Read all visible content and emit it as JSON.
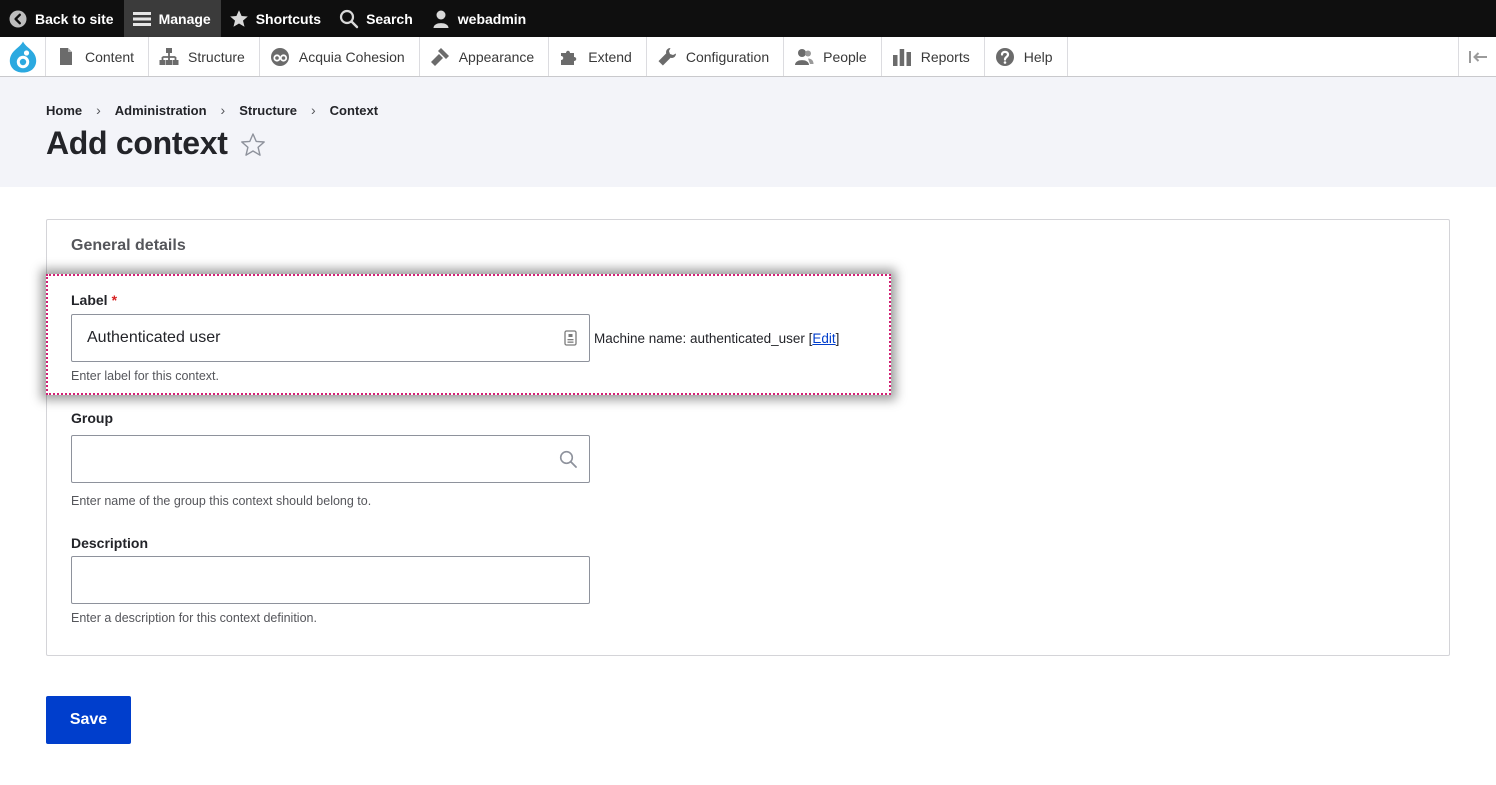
{
  "toolbar": {
    "back_to_site": "Back to site",
    "manage": "Manage",
    "shortcuts": "Shortcuts",
    "search": "Search",
    "user": "webadmin"
  },
  "tray": {
    "items": [
      {
        "label": "Content",
        "icon": "page-icon"
      },
      {
        "label": "Structure",
        "icon": "sitemap-icon"
      },
      {
        "label": "Acquia Cohesion",
        "icon": "cohesion-icon"
      },
      {
        "label": "Appearance",
        "icon": "paintbrush-icon"
      },
      {
        "label": "Extend",
        "icon": "puzzle-icon"
      },
      {
        "label": "Configuration",
        "icon": "wrench-icon"
      },
      {
        "label": "People",
        "icon": "people-icon"
      },
      {
        "label": "Reports",
        "icon": "bar-chart-icon"
      },
      {
        "label": "Help",
        "icon": "help-icon"
      }
    ]
  },
  "breadcrumb": [
    "Home",
    "Administration",
    "Structure",
    "Context"
  ],
  "page": {
    "title": "Add context"
  },
  "form": {
    "section_title": "General details",
    "label_field": {
      "label": "Label",
      "required_mark": "*",
      "value": "Authenticated user",
      "description": "Enter label for this context.",
      "machine_name_prefix": "Machine name: authenticated_user [",
      "machine_name_edit": "Edit",
      "machine_name_suffix": "]"
    },
    "group_field": {
      "label": "Group",
      "value": "",
      "description": "Enter name of the group this context should belong to."
    },
    "description_field": {
      "label": "Description",
      "value": "",
      "description": "Enter a description for this context definition."
    },
    "save_label": "Save"
  },
  "colors": {
    "toolbar_bg": "#0f0f0f",
    "header_bg": "#f3f4f9",
    "primary_button": "#003ecc",
    "link": "#003ecc",
    "highlight_border": "#d21f73",
    "required": "#d72222"
  }
}
